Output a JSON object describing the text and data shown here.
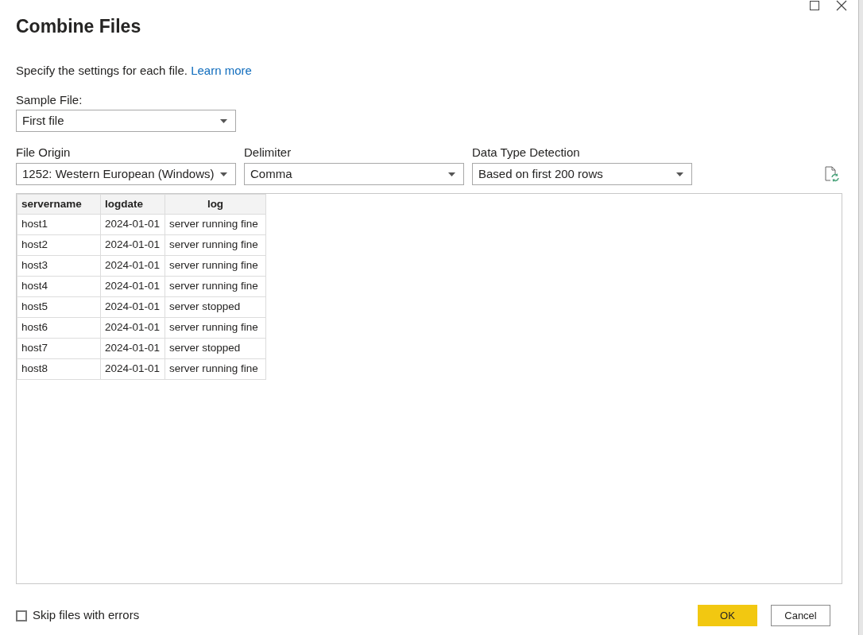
{
  "window": {
    "title": "Combine Files"
  },
  "intro": {
    "text": "Specify the settings for each file.",
    "link": "Learn more"
  },
  "sample_file": {
    "label": "Sample File:",
    "value": "First file"
  },
  "dropdowns": [
    {
      "label": "File Origin",
      "value": "1252: Western European (Windows)"
    },
    {
      "label": "Delimiter",
      "value": "Comma"
    },
    {
      "label": "Data Type Detection",
      "value": "Based on first 200 rows"
    }
  ],
  "table": {
    "columns": [
      "servername",
      "logdate",
      "log"
    ],
    "rows": [
      [
        "host1",
        "2024-01-01",
        "server running fine"
      ],
      [
        "host2",
        "2024-01-01",
        "server running fine"
      ],
      [
        "host3",
        "2024-01-01",
        "server running fine"
      ],
      [
        "host4",
        "2024-01-01",
        "server running fine"
      ],
      [
        "host5",
        "2024-01-01",
        "server stopped"
      ],
      [
        "host6",
        "2024-01-01",
        "server running fine"
      ],
      [
        "host7",
        "2024-01-01",
        "server stopped"
      ],
      [
        "host8",
        "2024-01-01",
        "server running fine"
      ]
    ]
  },
  "skip_errors": {
    "label": "Skip files with errors",
    "checked": false
  },
  "buttons": {
    "ok": "OK",
    "cancel": "Cancel"
  }
}
